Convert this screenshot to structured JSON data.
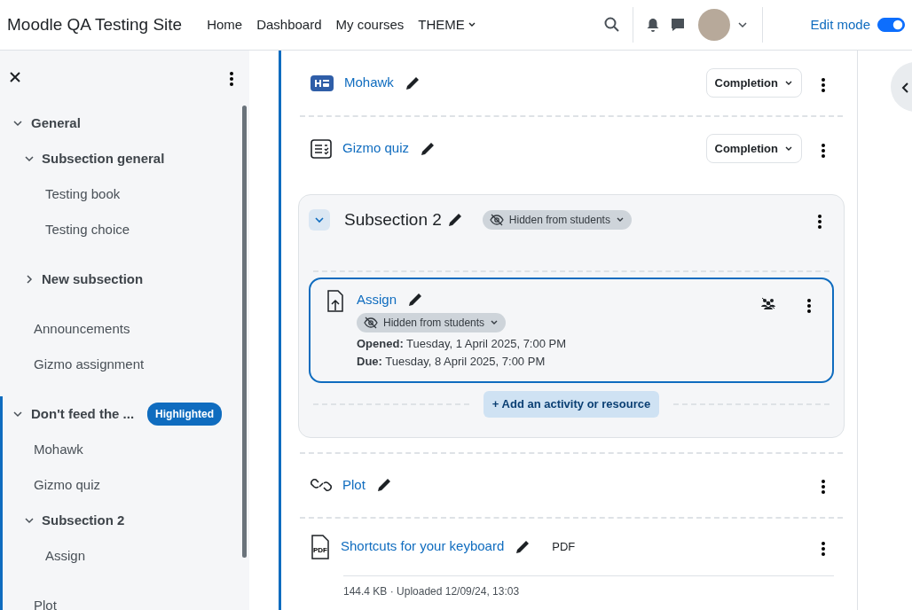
{
  "navbar": {
    "brand": "Moodle QA Testing Site",
    "links": [
      {
        "label": "Home",
        "dropdown": false
      },
      {
        "label": "Dashboard",
        "dropdown": false
      },
      {
        "label": "My courses",
        "dropdown": false
      },
      {
        "label": "THEME",
        "dropdown": true
      }
    ],
    "edit_mode": {
      "label": "Edit mode",
      "on": true
    }
  },
  "course_index": {
    "sections": [
      {
        "title": "General",
        "expanded": true,
        "highlighted": false,
        "children": [
          {
            "kind": "subsection",
            "title": "Subsection general",
            "expanded": true,
            "children": [
              {
                "kind": "item",
                "title": "Testing book"
              },
              {
                "kind": "item",
                "title": "Testing choice"
              }
            ]
          },
          {
            "kind": "subsection",
            "title": "New subsection",
            "expanded": false
          },
          {
            "kind": "item",
            "title": "Announcements"
          },
          {
            "kind": "item",
            "title": "Gizmo assignment"
          }
        ]
      },
      {
        "title": "Don't feed the ...",
        "expanded": true,
        "highlighted": true,
        "badge": "Highlighted",
        "children": [
          {
            "kind": "item",
            "title": "Mohawk"
          },
          {
            "kind": "item",
            "title": "Gizmo quiz"
          },
          {
            "kind": "subsection",
            "title": "Subsection 2",
            "expanded": true,
            "children": [
              {
                "kind": "item",
                "title": "Assign"
              }
            ]
          },
          {
            "kind": "item",
            "title": "Plot"
          }
        ]
      }
    ]
  },
  "content": [
    {
      "kind": "h5p",
      "name": "Mohawk",
      "completion": "Completion"
    },
    {
      "kind": "quiz",
      "name": "Gizmo quiz",
      "completion": "Completion"
    },
    {
      "kind": "subsection",
      "name": "Subsection 2",
      "expanded": true,
      "visibility": "Hidden from students",
      "add_button": "+ Add an activity or resource",
      "children": [
        {
          "kind": "assign",
          "name": "Assign",
          "selected": true,
          "visibility": "Hidden from students",
          "dates": [
            "**Opened:** Tuesday, 1 April 2025, 7:00 PM",
            "**Due:** Tuesday, 8 April 2025, 7:00 PM"
          ]
        }
      ]
    },
    {
      "kind": "url",
      "name": "Plot"
    },
    {
      "kind": "resource",
      "name": "Shortcuts for your keyboard",
      "icon_label": "PDF",
      "file_type": "PDF",
      "details": "144.4 KB · Uploaded 12/09/24, 13:03"
    }
  ]
}
